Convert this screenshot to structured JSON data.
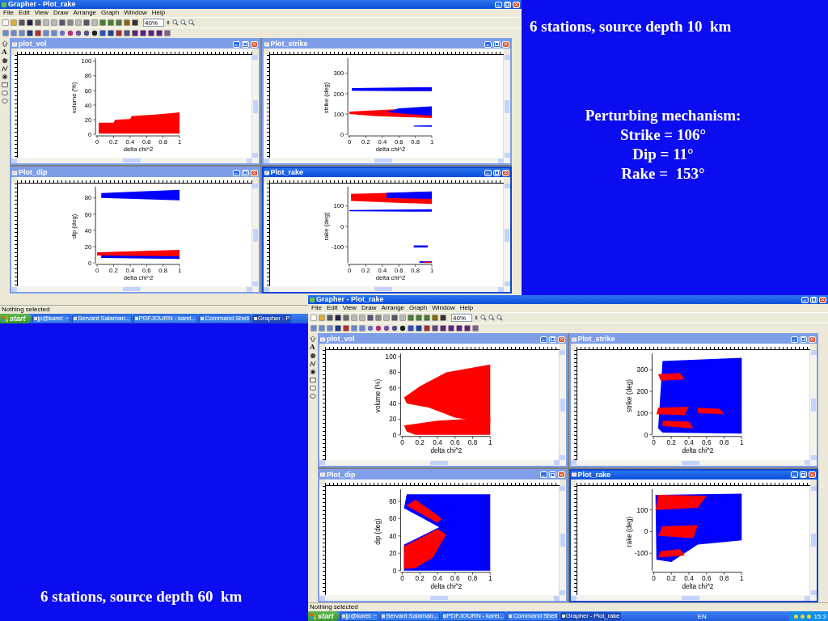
{
  "caption_top": "6 stations, source depth 10  km",
  "mechanism": {
    "title": "Perturbing mechanism:",
    "lines": [
      "Strike = 106°",
      "Dip = 11°",
      "Rake =  153°"
    ]
  },
  "caption_bottom": "6 stations, source depth 60  km",
  "windows": [
    {
      "title": "Grapher - Plot_rake",
      "menu": [
        "File",
        "Edit",
        "View",
        "Draw",
        "Arrange",
        "Graph",
        "Window",
        "Help"
      ],
      "zoom": "40%",
      "tools": [
        {
          "kind": "pointer"
        },
        {
          "kind": "text",
          "label": "A"
        },
        {
          "kind": "polygon"
        },
        {
          "kind": "polyline"
        },
        {
          "kind": "symbol"
        },
        {
          "kind": "rectangle"
        },
        {
          "kind": "rounded-rectangle"
        },
        {
          "kind": "ellipse"
        }
      ],
      "plots": [
        {
          "title": "plot_vol",
          "active": false,
          "ylabel": "volume (%)",
          "xlabel": "delta chi^2",
          "yticks": [
            "100",
            "80",
            "60",
            "40",
            "20",
            "0"
          ],
          "xticks": [
            "0",
            "0.2",
            "0.4",
            "0.6",
            "0.8",
            "1"
          ]
        },
        {
          "title": "Plot_strike",
          "active": false,
          "ylabel": "strike (deg)",
          "xlabel": "delta chi^2",
          "yticks": [
            "300",
            "200",
            "100",
            "0"
          ],
          "xticks": [
            "0",
            "0.2",
            "0.4",
            "0.6",
            "0.8",
            "1"
          ]
        },
        {
          "title": "Plot_dip",
          "active": false,
          "ylabel": "dip (deg)",
          "xlabel": "delta chi^2",
          "yticks": [
            "80",
            "60",
            "40",
            "20",
            "0"
          ],
          "xticks": [
            "0",
            "0.2",
            "0.4",
            "0.6",
            "0.8",
            "1"
          ]
        },
        {
          "title": "Plot_rake",
          "active": true,
          "ylabel": "rake (deg)",
          "xlabel": "delta chi^2",
          "yticks": [
            "100",
            "0",
            "-100"
          ],
          "xticks": [
            "0",
            "0.2",
            "0.4",
            "0.6",
            "0.8",
            "1"
          ]
        }
      ],
      "status": "Nothing selected",
      "taskbar": {
        "start": "start",
        "tasks": [
          {
            "label": "jp@karel: ~",
            "selected": false
          },
          {
            "label": "Servant Salaman...",
            "selected": false
          },
          {
            "label": "PDFJOURN - karel...",
            "selected": false
          },
          {
            "label": "Command Shell",
            "selected": false
          },
          {
            "label": "Grapher - P",
            "selected": true
          }
        ]
      }
    },
    {
      "title": "Grapher - Plot_rake",
      "menu": [
        "File",
        "Edit",
        "View",
        "Draw",
        "Arrange",
        "Graph",
        "Window",
        "Help"
      ],
      "zoom": "40%",
      "tools": [
        {
          "kind": "pointer"
        },
        {
          "kind": "text",
          "label": "A"
        },
        {
          "kind": "polygon"
        },
        {
          "kind": "polyline"
        },
        {
          "kind": "symbol"
        },
        {
          "kind": "rectangle"
        },
        {
          "kind": "rounded-rectangle"
        },
        {
          "kind": "ellipse"
        }
      ],
      "plots": [
        {
          "title": "plot_vol",
          "active": false,
          "ylabel": "volume (%)",
          "xlabel": "delta chi^2",
          "yticks": [
            "100",
            "80",
            "60",
            "40",
            "20",
            "0"
          ],
          "xticks": [
            "0",
            "0.2",
            "0.4",
            "0.6",
            "0.8",
            "1"
          ]
        },
        {
          "title": "Plot_strike",
          "active": false,
          "ylabel": "strike (deg)",
          "xlabel": "delta chi^2",
          "yticks": [
            "300",
            "200",
            "100",
            "0"
          ],
          "xticks": [
            "0",
            "0.2",
            "0.4",
            "0.6",
            "0.8",
            "1"
          ]
        },
        {
          "title": "Plot_dip",
          "active": false,
          "ylabel": "dip (deg)",
          "xlabel": "delta chi^2",
          "yticks": [
            "80",
            "60",
            "40",
            "20",
            "0"
          ],
          "xticks": [
            "0",
            "0.2",
            "0.4",
            "0.6",
            "0.8",
            "1"
          ]
        },
        {
          "title": "Plot_rake",
          "active": true,
          "ylabel": "rake (deg)",
          "xlabel": "delta chi^2",
          "yticks": [
            "100",
            "0",
            "-100"
          ],
          "xticks": [
            "0",
            "0.2",
            "0.4",
            "0.6",
            "0.8",
            "1"
          ]
        }
      ],
      "status": "Nothing selected",
      "taskbar": {
        "start": "start",
        "tasks": [
          {
            "label": "jp@karel: ~",
            "selected": false
          },
          {
            "label": "Servant Salaman...",
            "selected": false
          },
          {
            "label": "PDFJOURN - karel...",
            "selected": false
          },
          {
            "label": "Command Shell",
            "selected": false
          },
          {
            "label": "Grapher - Plot_rake",
            "selected": true
          }
        ],
        "tray": {
          "language": "EN",
          "clock": "15:3"
        }
      }
    }
  ]
}
